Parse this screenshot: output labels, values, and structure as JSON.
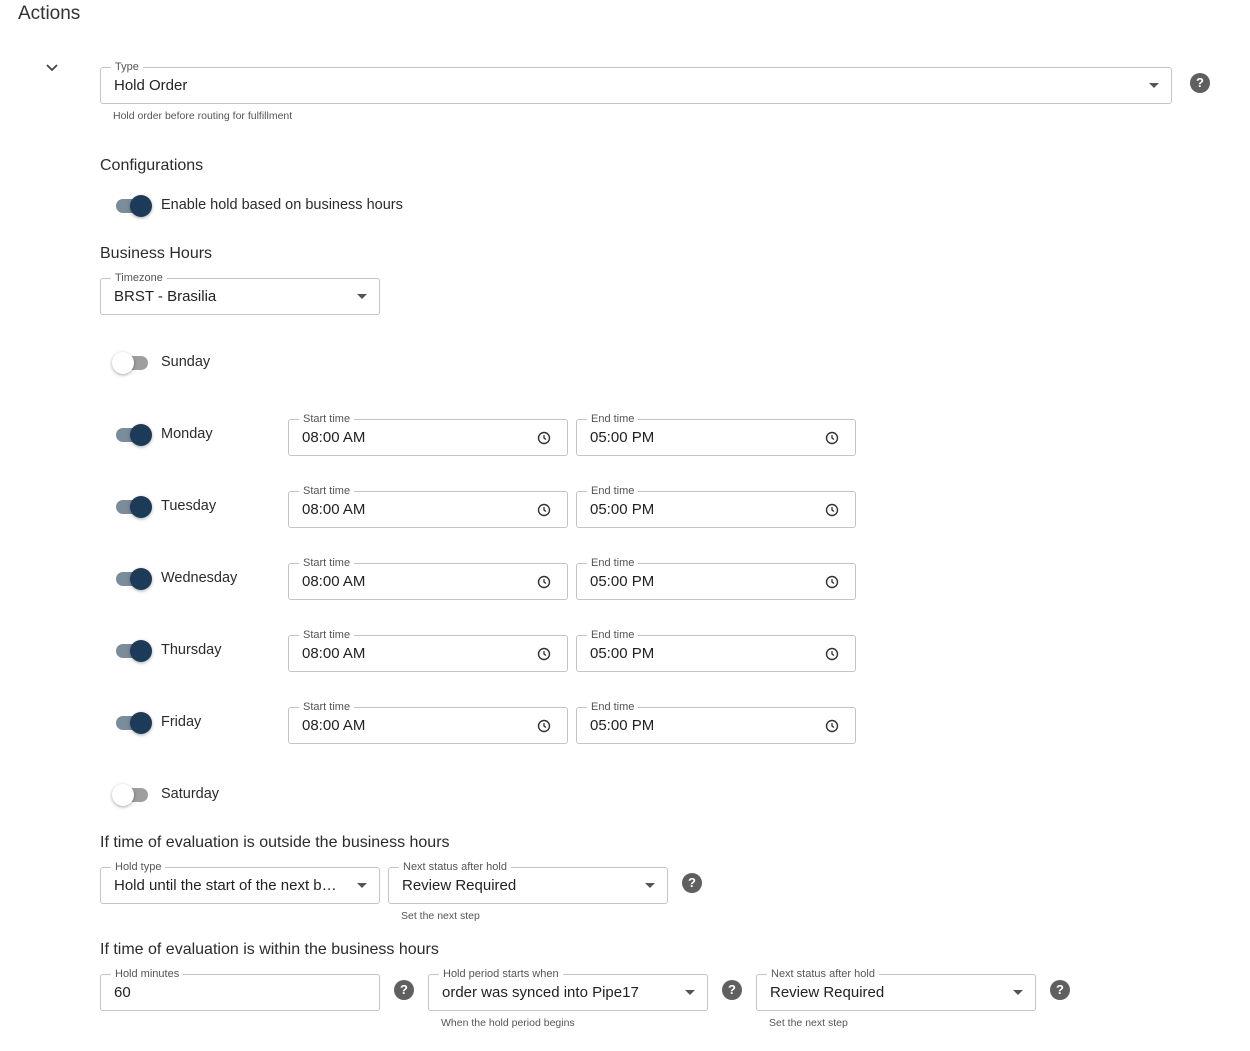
{
  "section": {
    "title": "Actions"
  },
  "type_field": {
    "label": "Type",
    "value": "Hold Order",
    "helper": "Hold order before routing for fulfillment"
  },
  "configurations": {
    "title": "Configurations",
    "enable_label": "Enable hold based on business hours",
    "enable_on": true
  },
  "business_hours": {
    "title": "Business Hours",
    "timezone": {
      "label": "Timezone",
      "value": "BRST - Brasilia"
    },
    "start_label": "Start time",
    "end_label": "End time",
    "days": [
      {
        "name": "Sunday",
        "enabled": false
      },
      {
        "name": "Monday",
        "enabled": true,
        "start": "08:00 AM",
        "end": "05:00 PM"
      },
      {
        "name": "Tuesday",
        "enabled": true,
        "start": "08:00 AM",
        "end": "05:00 PM"
      },
      {
        "name": "Wednesday",
        "enabled": true,
        "start": "08:00 AM",
        "end": "05:00 PM"
      },
      {
        "name": "Thursday",
        "enabled": true,
        "start": "08:00 AM",
        "end": "05:00 PM"
      },
      {
        "name": "Friday",
        "enabled": true,
        "start": "08:00 AM",
        "end": "05:00 PM"
      },
      {
        "name": "Saturday",
        "enabled": false
      }
    ]
  },
  "outside": {
    "title": "If time of evaluation is outside the business hours",
    "hold_type": {
      "label": "Hold type",
      "value": "Hold until the start of the next business day"
    },
    "next_status": {
      "label": "Next status after hold",
      "value": "Review Required",
      "helper": "Set the next step"
    }
  },
  "within": {
    "title": "If time of evaluation is within the business hours",
    "hold_minutes": {
      "label": "Hold minutes",
      "value": "60"
    },
    "hold_start": {
      "label": "Hold period starts when",
      "value": "order was synced into Pipe17",
      "helper": "When the hold period begins"
    },
    "next_status": {
      "label": "Next status after hold",
      "value": "Review Required",
      "helper": "Set the next step"
    }
  },
  "help_symbol": "?",
  "icons": [
    "chevron-down-icon",
    "dropdown-caret-icon",
    "clock-icon",
    "help-icon"
  ],
  "colors": {
    "toggle_on_thumb": "#1d3b58",
    "toggle_on_track": "#7b8c9a",
    "toggle_off_track": "#9e9e9e",
    "help_bg": "#5f5f5f"
  }
}
